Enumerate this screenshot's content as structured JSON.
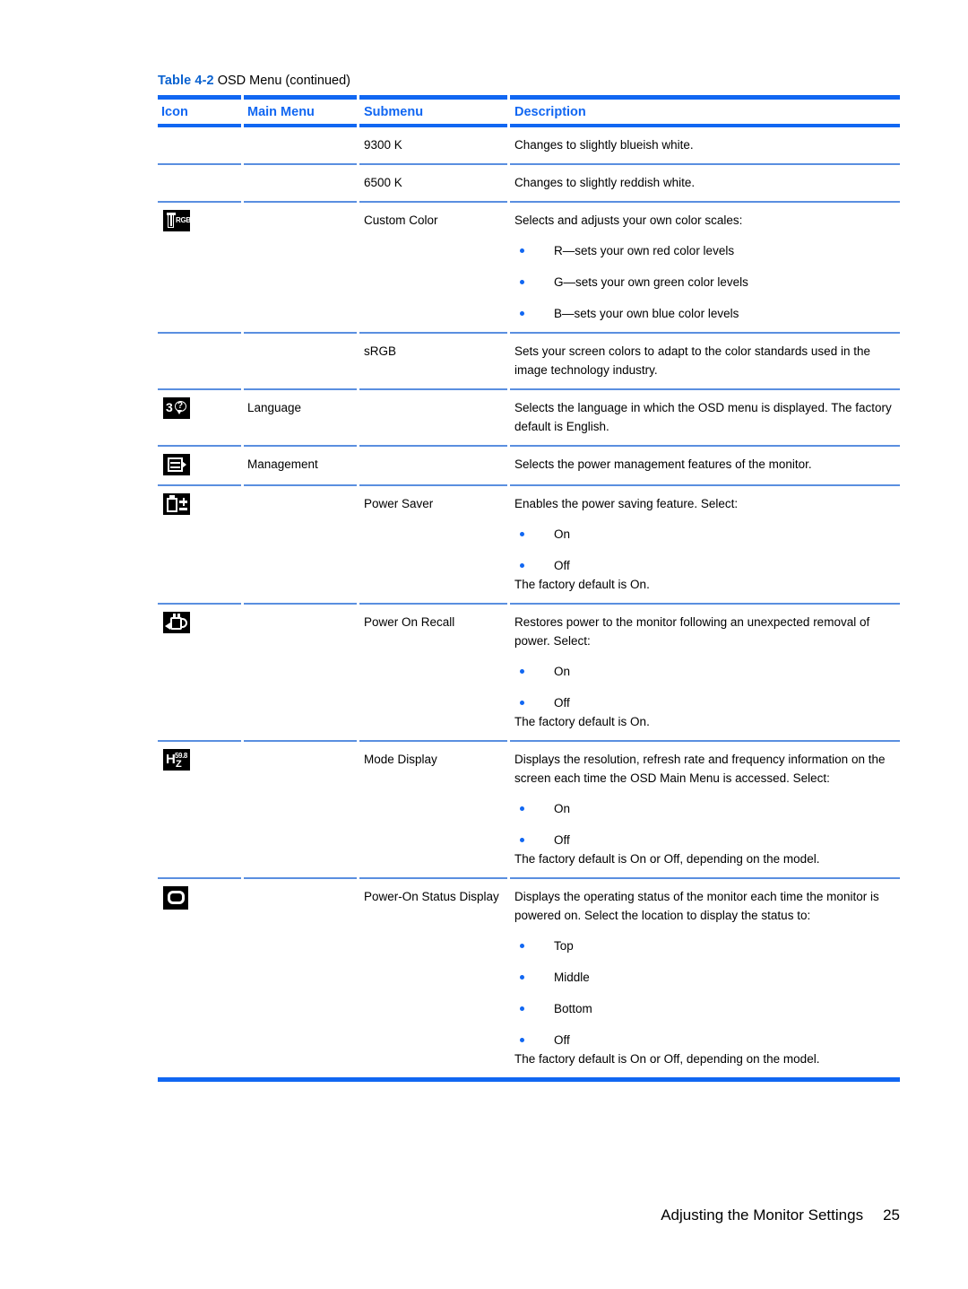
{
  "caption": {
    "label": "Table 4-2",
    "text": "OSD Menu (continued)"
  },
  "colors": {
    "accent_blue": "#1167f2",
    "caption_blue": "#0a62d0",
    "row_rule_blue": "#5a8fe0",
    "bullet_blue": "#1167f2"
  },
  "table": {
    "headers": {
      "icon": "Icon",
      "main_menu": "Main Menu",
      "submenu": "Submenu",
      "description": "Description"
    },
    "rows": [
      {
        "icon": "",
        "main_menu": "",
        "submenu": "9300 K",
        "description": [
          "Changes to slightly blueish white."
        ],
        "bullets": []
      },
      {
        "icon": "",
        "main_menu": "",
        "submenu": "6500 K",
        "description": [
          "Changes to slightly reddish white."
        ],
        "bullets": []
      },
      {
        "icon": "rgb-slider-icon",
        "main_menu": "",
        "submenu": "Custom Color",
        "description": [
          "Selects and adjusts your own color scales:"
        ],
        "bullets": [
          "R—sets your own red color levels",
          "G—sets your own green color levels",
          "B—sets your own blue color levels"
        ]
      },
      {
        "icon": "",
        "main_menu": "",
        "submenu": "sRGB",
        "description": [
          "Sets your screen colors to adapt to the color standards used in the image technology industry."
        ],
        "bullets": []
      },
      {
        "icon": "language-icon",
        "main_menu": "Language",
        "submenu": "",
        "description": [
          "Selects the language in which the OSD menu is displayed. The factory default is English."
        ],
        "bullets": []
      },
      {
        "icon": "management-icon",
        "main_menu": "Management",
        "submenu": "",
        "description": [
          "Selects the power management features of the monitor."
        ],
        "bullets": []
      },
      {
        "icon": "battery-power-saver-icon",
        "main_menu": "",
        "submenu": "Power Saver",
        "description": [
          "Enables the power saving feature. Select:"
        ],
        "bullets": [
          "On",
          "Off"
        ],
        "after": [
          "The factory default is On."
        ]
      },
      {
        "icon": "power-on-recall-icon",
        "main_menu": "",
        "submenu": "Power On Recall",
        "description": [
          "Restores power to the monitor following an unexpected removal of power. Select:"
        ],
        "bullets": [
          "On",
          "Off"
        ],
        "after": [
          "The factory default is On."
        ]
      },
      {
        "icon": "mode-display-hz-icon",
        "main_menu": "",
        "submenu": "Mode Display",
        "description": [
          "Displays the resolution, refresh rate and frequency information on the screen each time the OSD Main Menu is accessed. Select:"
        ],
        "bullets": [
          "On",
          "Off"
        ],
        "after": [
          "The factory default is On or Off, depending on the model."
        ]
      },
      {
        "icon": "power-on-status-display-icon",
        "main_menu": "",
        "submenu": "Power-On Status Display",
        "description": [
          "Displays the operating status of the monitor each time the monitor is powered on. Select the location to display the status to:"
        ],
        "bullets": [
          "Top",
          "Middle",
          "Bottom",
          "Off"
        ],
        "after": [
          "The factory default is On or Off, depending on the model."
        ]
      }
    ]
  },
  "icon_glyphs": {
    "rgb_text_line1": "RGB",
    "language_char": "3",
    "language_question": "?",
    "hz_h": "H",
    "hz_num": "59.8",
    "hz_z": "Z"
  },
  "footer": {
    "chapter": "Adjusting the Monitor Settings",
    "page_number": "25"
  }
}
